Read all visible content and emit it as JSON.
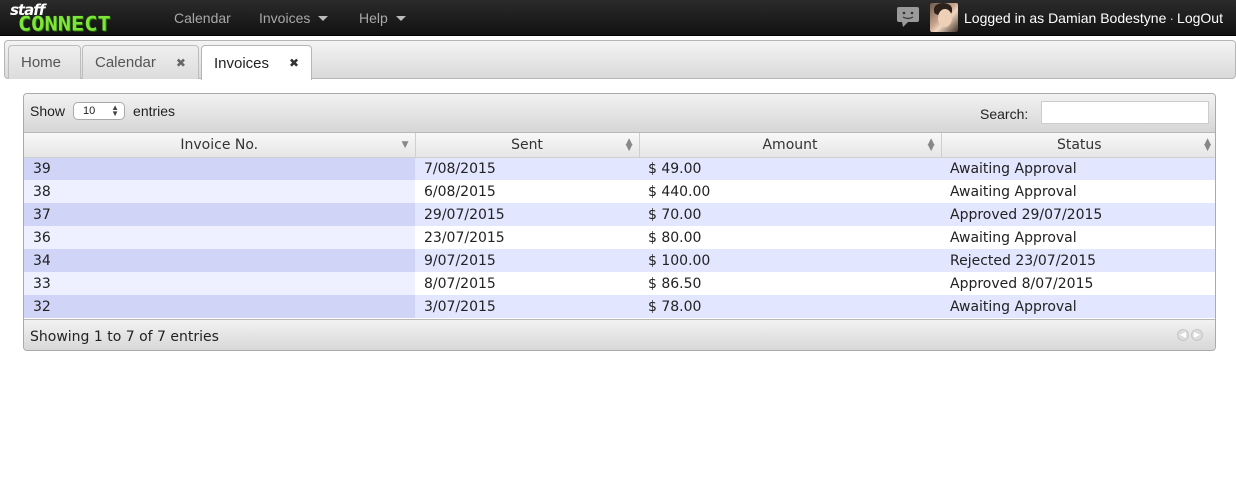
{
  "brand": {
    "line1": "staff",
    "line2": "CONNECT"
  },
  "nav": {
    "items": [
      {
        "label": "Calendar",
        "dropdown": false
      },
      {
        "label": "Invoices",
        "dropdown": true
      },
      {
        "label": "Help",
        "dropdown": true
      }
    ],
    "login_text": "Logged in as Damian Bodestyne",
    "separator": "·",
    "logout": "LogOut",
    "icons": [
      "chat-icon",
      "avatar"
    ]
  },
  "tabs": [
    {
      "label": "Home",
      "closable": false,
      "active": false
    },
    {
      "label": "Calendar",
      "closable": true,
      "active": false
    },
    {
      "label": "Invoices",
      "closable": true,
      "active": true
    }
  ],
  "tab_close_glyph": "✖",
  "table_controls": {
    "show_label": "Show",
    "page_size": "10",
    "entries_label": "entries",
    "search_label": "Search:",
    "search_value": ""
  },
  "table": {
    "columns": [
      "Invoice No.",
      "Sent",
      "Amount",
      "Status"
    ],
    "rows": [
      [
        "39",
        "7/08/2015",
        "$ 49.00",
        "Awaiting Approval"
      ],
      [
        "38",
        "6/08/2015",
        "$ 440.00",
        "Awaiting Approval"
      ],
      [
        "37",
        "29/07/2015",
        "$ 70.00",
        "Approved 29/07/2015"
      ],
      [
        "36",
        "23/07/2015",
        "$ 80.00",
        "Awaiting Approval"
      ],
      [
        "34",
        "9/07/2015",
        "$ 100.00",
        "Rejected 23/07/2015"
      ],
      [
        "33",
        "8/07/2015",
        "$ 86.50",
        "Approved 8/07/2015"
      ],
      [
        "32",
        "3/07/2015",
        "$ 78.00",
        "Awaiting Approval"
      ]
    ],
    "info": "Showing 1 to 7 of 7 entries"
  },
  "colors": {
    "brand_green": "#7ee53a",
    "row_odd": "#e3e6ff",
    "row_odd_sorted": "#d0d4f7",
    "nav_bg": "#1c1c1c"
  }
}
